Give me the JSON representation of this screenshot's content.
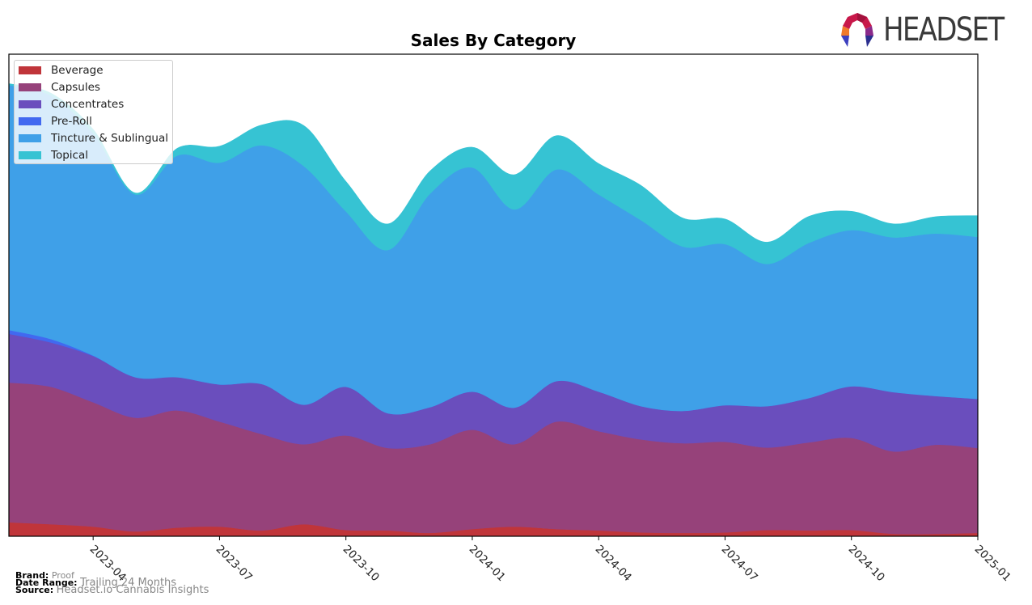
{
  "brand_logo": {
    "text": "HEADSET"
  },
  "chart_data": {
    "type": "area",
    "stacked": true,
    "title": "Sales By Category",
    "xlabel": "",
    "ylabel": "",
    "y_units": "relative (unlabeled axis, scaled 0-100 of plot height)",
    "ylim": [
      0,
      100
    ],
    "x": [
      "2023-02",
      "2023-03",
      "2023-04",
      "2023-05",
      "2023-06",
      "2023-07",
      "2023-08",
      "2023-09",
      "2023-10",
      "2023-11",
      "2023-12",
      "2024-01",
      "2024-02",
      "2024-03",
      "2024-04",
      "2024-05",
      "2024-06",
      "2024-07",
      "2024-08",
      "2024-09",
      "2024-10",
      "2024-11",
      "2024-12",
      "2025-01"
    ],
    "x_ticks": [
      "2023-04",
      "2023-07",
      "2023-10",
      "2024-01",
      "2024-04",
      "2024-07",
      "2024-10",
      "2025-01"
    ],
    "grid": false,
    "legend_position": "top-left",
    "series": [
      {
        "name": "Beverage",
        "color": "#c0353a",
        "values": [
          2.9,
          2.5,
          2.0,
          1.0,
          1.8,
          2.0,
          1.2,
          2.5,
          1.3,
          1.2,
          0.7,
          1.5,
          2.0,
          1.5,
          1.2,
          0.8,
          0.7,
          0.8,
          1.3,
          1.2,
          1.3,
          0.5,
          0.5,
          0.7
        ]
      },
      {
        "name": "Capsules",
        "color": "#96427a",
        "values": [
          29.0,
          28.5,
          25.8,
          23.6,
          24.3,
          21.8,
          20.0,
          16.6,
          19.6,
          17.1,
          18.4,
          20.6,
          17.1,
          22.3,
          20.6,
          19.3,
          18.6,
          18.8,
          17.1,
          18.3,
          19.1,
          17.1,
          18.5,
          17.6
        ]
      },
      {
        "name": "Concentrates",
        "color": "#6a4ebd",
        "values": [
          10.1,
          9.2,
          9.6,
          8.4,
          6.9,
          7.7,
          10.4,
          8.2,
          10.1,
          7.2,
          7.7,
          7.9,
          7.6,
          8.4,
          8.2,
          6.9,
          6.7,
          7.6,
          8.6,
          9.2,
          10.7,
          12.3,
          10.1,
          10.2
        ]
      },
      {
        "name": "Pre-Roll",
        "color": "#4169f0",
        "values": [
          0.8,
          0.7,
          0.1,
          0,
          0,
          0,
          0,
          0,
          0,
          0,
          0,
          0,
          0,
          0,
          0,
          0,
          0,
          0,
          0,
          0,
          0,
          0,
          0,
          0
        ]
      },
      {
        "name": "Tincture & Sublingual",
        "color": "#3fa0e8",
        "values": [
          50.8,
          50.5,
          46.1,
          37.9,
          46.0,
          46.0,
          49.5,
          49.5,
          36.4,
          33.9,
          44.3,
          46.5,
          41.1,
          43.9,
          40.9,
          38.6,
          34.1,
          33.4,
          29.5,
          32.2,
          32.4,
          32.1,
          33.7,
          33.6
        ]
      },
      {
        "name": "Topical",
        "color": "#36c3d3",
        "values": [
          0.3,
          0.5,
          0.8,
          0.3,
          1.5,
          3.4,
          4.2,
          8.4,
          6.2,
          5.4,
          4.7,
          4.2,
          7.2,
          7.0,
          6.4,
          7.2,
          5.9,
          5.2,
          4.5,
          5.5,
          3.9,
          2.8,
          3.5,
          4.4
        ]
      }
    ]
  },
  "footer": {
    "brand_label": "Brand:",
    "brand_value": "Proof",
    "date_range_label": "Date Range:",
    "date_range_value": "Trailing 24 Months",
    "source_label": "Source:",
    "source_value": "Headset.io Cannabis Insights"
  }
}
